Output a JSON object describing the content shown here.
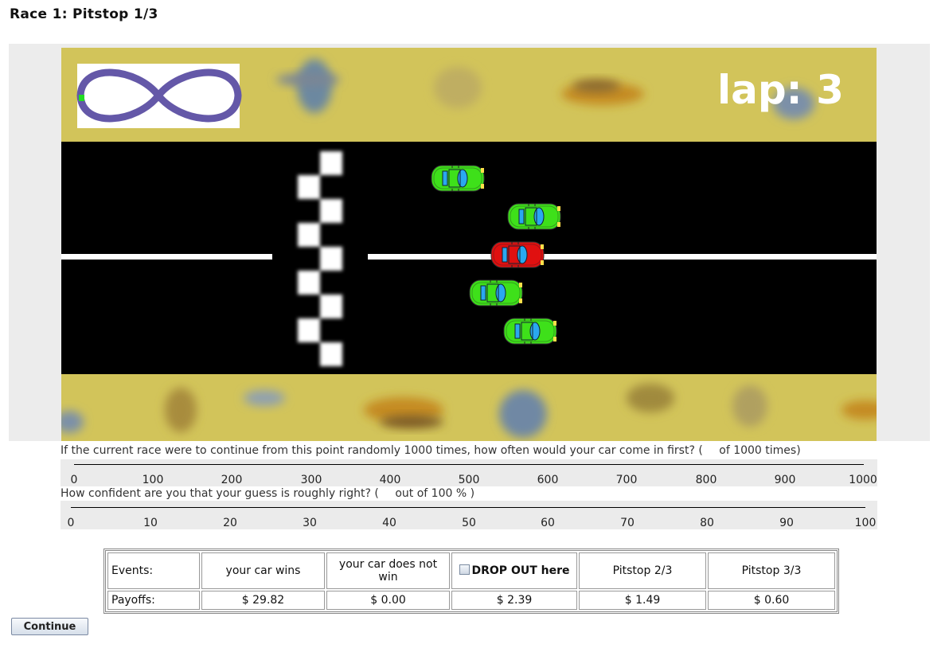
{
  "page": {
    "title": "Race 1: Pitstop 1/3"
  },
  "game": {
    "lap_label": "lap: 3",
    "colors": {
      "grass": "#d2c45a",
      "road": "#000000",
      "track_map": "#6458a8",
      "player_car": "#e01010",
      "other_car": "#3ee01a",
      "window": "#2aa8f0"
    },
    "cars": [
      "other-car",
      "other-car",
      "player-car",
      "other-car",
      "other-car"
    ]
  },
  "question1": {
    "text": "If the current race were to continue from this point randomly 1000 times, how often would your car come in first? (",
    "text_suffix": " of 1000 times)",
    "ticks": [
      "0",
      "100",
      "200",
      "300",
      "400",
      "500",
      "600",
      "700",
      "800",
      "900",
      "1000"
    ]
  },
  "question2": {
    "text": "How confident are you that your guess is roughly right?  (",
    "text_suffix": " out of 100 % )",
    "ticks": [
      "0",
      "10",
      "20",
      "30",
      "40",
      "50",
      "60",
      "70",
      "80",
      "90",
      "100"
    ]
  },
  "table": {
    "events_label": "Events:",
    "payoffs_label": "Payoffs:",
    "columns": [
      {
        "event": "your car wins",
        "payoff": "$ 29.82"
      },
      {
        "event": "your car does not win",
        "payoff": "$ 0.00"
      },
      {
        "event": "DROP OUT here",
        "payoff": "$ 2.39"
      },
      {
        "event": "Pitstop 2/3",
        "payoff": "$ 1.49"
      },
      {
        "event": "Pitstop 3/3",
        "payoff": "$ 0.60"
      }
    ]
  },
  "continue_label": "Continue"
}
